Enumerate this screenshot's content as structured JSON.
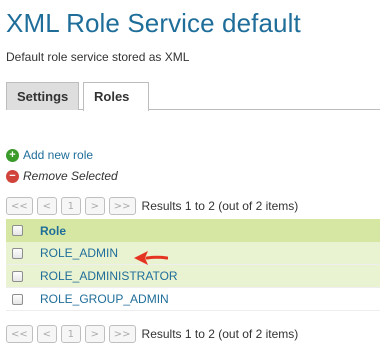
{
  "page": {
    "title": "XML Role Service default",
    "subtitle": "Default role service stored as XML"
  },
  "tabs": [
    {
      "label": "Settings",
      "active": false
    },
    {
      "label": "Roles",
      "active": true
    }
  ],
  "actions": {
    "add_label": "Add new role",
    "remove_label": "Remove Selected"
  },
  "pager": {
    "first": "<<",
    "prev": "<",
    "current": "1",
    "next": ">",
    "last": ">>",
    "info": "Results 1 to 2 (out of 2 items)"
  },
  "table": {
    "column": "Role",
    "rows": [
      "ROLE_ADMIN",
      "ROLE_ADMINISTRATOR",
      "ROLE_GROUP_ADMIN"
    ]
  },
  "colors": {
    "title": "#1f6e9a",
    "header_bg": "#d5e7a2",
    "row_alt_bg": "#eaf3d1",
    "arrow": "#e53322"
  },
  "icons": [
    "add-icon",
    "remove-icon",
    "red-arrow-icon"
  ]
}
